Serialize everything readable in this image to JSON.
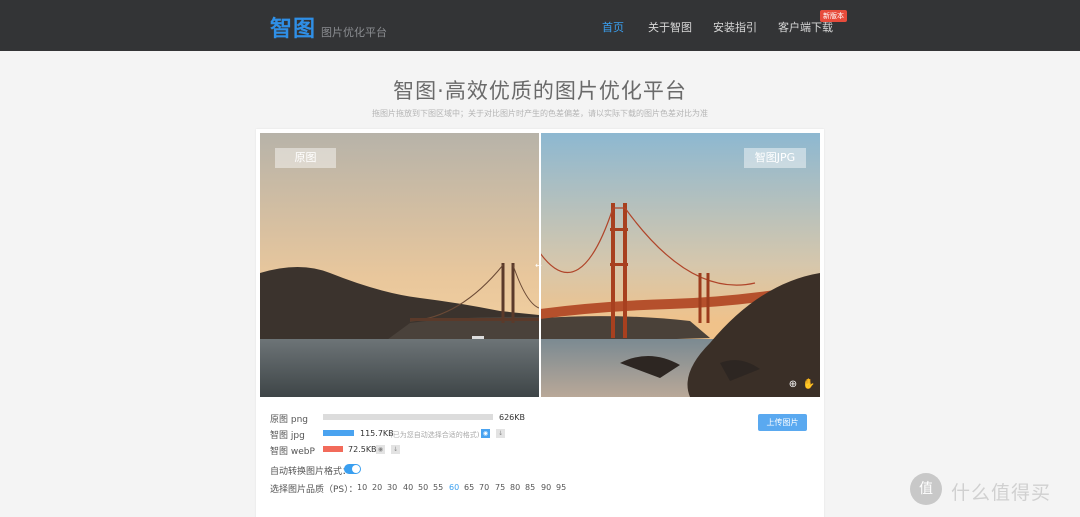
{
  "header": {
    "logo": "智图",
    "subtitle": "图片优化平台",
    "nav": [
      "首页",
      "关于智图",
      "安装指引",
      "客户端下载"
    ],
    "active_nav": "首页",
    "badge": "新版本"
  },
  "hero": {
    "title": "智图·高效优质的图片优化平台",
    "subtitle": "拖图片拖放到下图区域中；关于对比图片时产生的色差偏差，请以实际下载的图片色差对比为准"
  },
  "compare": {
    "left_label": "原图",
    "right_label": "智图JPG"
  },
  "rows": [
    {
      "label": "原图 png",
      "size": "626KB",
      "fill": 1.0,
      "color": "#dcdcdc"
    },
    {
      "label": "智图 jpg",
      "size": "115.7KB",
      "fill": 0.185,
      "color": "#4aa3f0",
      "note": "(已为您自动选择合适的格式)"
    },
    {
      "label": "智图 webP",
      "size": "72.5KB",
      "fill": 0.116,
      "color": "#f26b5b"
    }
  ],
  "upload_label": "上传图片",
  "auto_convert_label": "自动转换图片格式：",
  "auto_convert_on": true,
  "quality": {
    "label": "选择图片品质（PS）：",
    "options": [
      "10",
      "20",
      "30",
      "40",
      "50",
      "55",
      "60",
      "65",
      "70",
      "75",
      "80",
      "85",
      "90",
      "95"
    ],
    "selected": "60"
  },
  "watermark": {
    "glyph": "值",
    "text": "什么值得买"
  },
  "icons": {
    "zoom": "zoom-in-icon",
    "hand": "hand-drag-icon",
    "view": "eye-icon",
    "download": "download-icon"
  },
  "colors": {
    "accent": "#3a9ff0",
    "topbar": "#333436",
    "webp": "#f26b5b"
  }
}
